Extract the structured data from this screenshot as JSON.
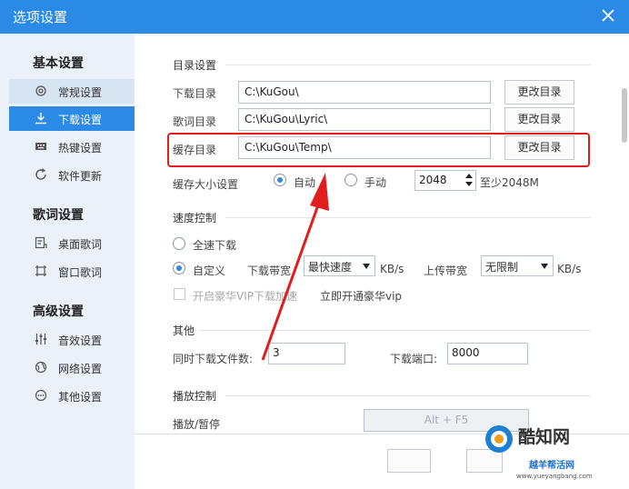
{
  "window": {
    "title": "选项设置",
    "close_icon": "close-icon"
  },
  "sidebar": {
    "sections": [
      {
        "title": "基本设置",
        "items": [
          {
            "label": "常规设置",
            "icon": "gear-icon"
          },
          {
            "label": "下载设置",
            "icon": "download-icon"
          },
          {
            "label": "热键设置",
            "icon": "keyboard-icon"
          },
          {
            "label": "软件更新",
            "icon": "refresh-icon"
          }
        ]
      },
      {
        "title": "歌词设置",
        "items": [
          {
            "label": "桌面歌词",
            "icon": "desktop-lyric-icon"
          },
          {
            "label": "窗口歌词",
            "icon": "window-lyric-icon"
          }
        ]
      },
      {
        "title": "高级设置",
        "items": [
          {
            "label": "音效设置",
            "icon": "equalizer-icon"
          },
          {
            "label": "网络设置",
            "icon": "globe-icon"
          },
          {
            "label": "其他设置",
            "icon": "more-icon"
          }
        ]
      }
    ]
  },
  "directory": {
    "title": "目录设置",
    "download_label": "下载目录",
    "download_value": "C:\\KuGou\\",
    "lyric_label": "歌词目录",
    "lyric_value": "C:\\KuGou\\Lyric\\",
    "cache_label": "缓存目录",
    "cache_value": "C:\\KuGou\\Temp\\",
    "change_button": "更改目录",
    "cache_size_label": "缓存大小设置",
    "auto_label": "自动",
    "manual_label": "手动",
    "size_value": "2048",
    "size_hint": "至少2048M"
  },
  "speed": {
    "title": "速度控制",
    "full_label": "全速下载",
    "custom_label": "自定义",
    "down_bw_label": "下载带宽",
    "down_bw_value": "最快速度",
    "down_unit": "KB/s",
    "up_bw_label": "上传带宽",
    "up_bw_value": "无限制",
    "up_unit": "KB/s",
    "vip_label": "开启豪华VIP下载加速",
    "vip_link": "立即开通豪华vip"
  },
  "other": {
    "title": "其他",
    "concurrent_label": "同时下载文件数:",
    "concurrent_value": "3",
    "port_label": "下载端口:",
    "port_value": "8000"
  },
  "playback": {
    "title": "播放控制",
    "play_pause_label": "播放/暂停",
    "play_pause_value": "Alt + F5"
  },
  "colors": {
    "accent": "#2b8ae5",
    "sidebar_bg": "#eaf1f9",
    "highlight": "#e11d1d"
  },
  "watermark": {
    "brand": "酷知网",
    "domain": "www.yueyangbang.com",
    "sub": "越羊帮活网"
  }
}
